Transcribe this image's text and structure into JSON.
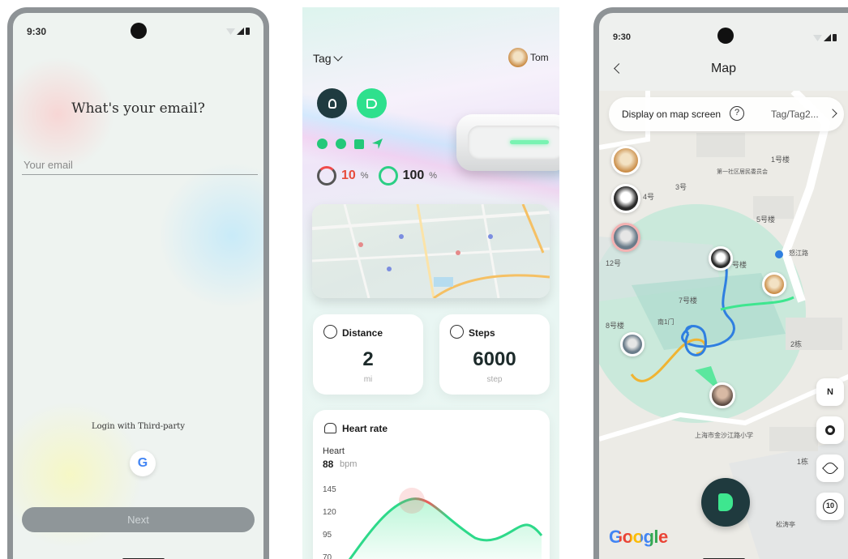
{
  "screen_email": {
    "status_time": "9:30",
    "title": "What's your email?",
    "email_placeholder": "Your email",
    "third_party_label": "Login with Third-party",
    "google_glyph": "G",
    "next_label": "Next"
  },
  "screen_tag": {
    "tag_selector": "Tag",
    "user_name": "Tom",
    "battery_tag": "10",
    "battery_phone": "100",
    "percent_sign": "%",
    "distance": {
      "label": "Distance",
      "value": "2",
      "unit": "mi"
    },
    "steps": {
      "label": "Steps",
      "value": "6000",
      "unit": "step"
    },
    "heart": {
      "title": "Heart rate",
      "label": "Heart",
      "value": "88",
      "unit": "bpm",
      "y_ticks": [
        "145",
        "120",
        "95",
        "70"
      ]
    },
    "colors": {
      "dark": "#1f3b40",
      "accent": "#2ee08d",
      "warning": "#e74c3c"
    }
  },
  "screen_map": {
    "status_time": "9:30",
    "title": "Map",
    "display_label": "Display on map screen",
    "help_glyph": "?",
    "tag_value": "Tag/Tag2...",
    "compass_label": "N",
    "replay_label": "10",
    "google_logo": "Google",
    "map_labels": [
      {
        "text": "1号楼"
      },
      {
        "text": "第一社区居民委员会"
      },
      {
        "text": "3号"
      },
      {
        "text": "4号"
      },
      {
        "text": "5号楼"
      },
      {
        "text": "12号"
      },
      {
        "text": "号楼"
      },
      {
        "text": "7号楼"
      },
      {
        "text": "南1门"
      },
      {
        "text": "8号楼"
      },
      {
        "text": "2栋"
      },
      {
        "text": "上海市金沙江路小学"
      },
      {
        "text": "1栋"
      },
      {
        "text": "松涛亭"
      },
      {
        "text": "怒江路"
      }
    ]
  }
}
